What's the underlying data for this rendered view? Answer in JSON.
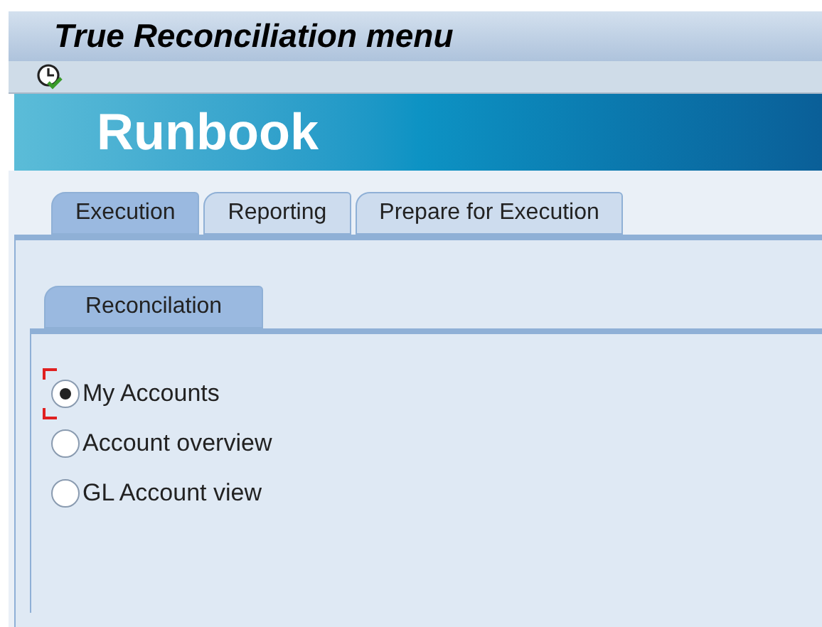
{
  "window": {
    "title": "True Reconciliation menu"
  },
  "banner": {
    "title": "Runbook"
  },
  "tabs": [
    {
      "label": "Execution",
      "selected": true
    },
    {
      "label": "Reporting",
      "selected": false
    },
    {
      "label": "Prepare for Execution",
      "selected": false
    }
  ],
  "subtabs": [
    {
      "label": "Reconcilation",
      "selected": true
    }
  ],
  "options": [
    {
      "label": "My Accounts",
      "selected": true,
      "focused": true
    },
    {
      "label": "Account overview",
      "selected": false,
      "focused": false
    },
    {
      "label": "GL Account view",
      "selected": false,
      "focused": false
    }
  ]
}
